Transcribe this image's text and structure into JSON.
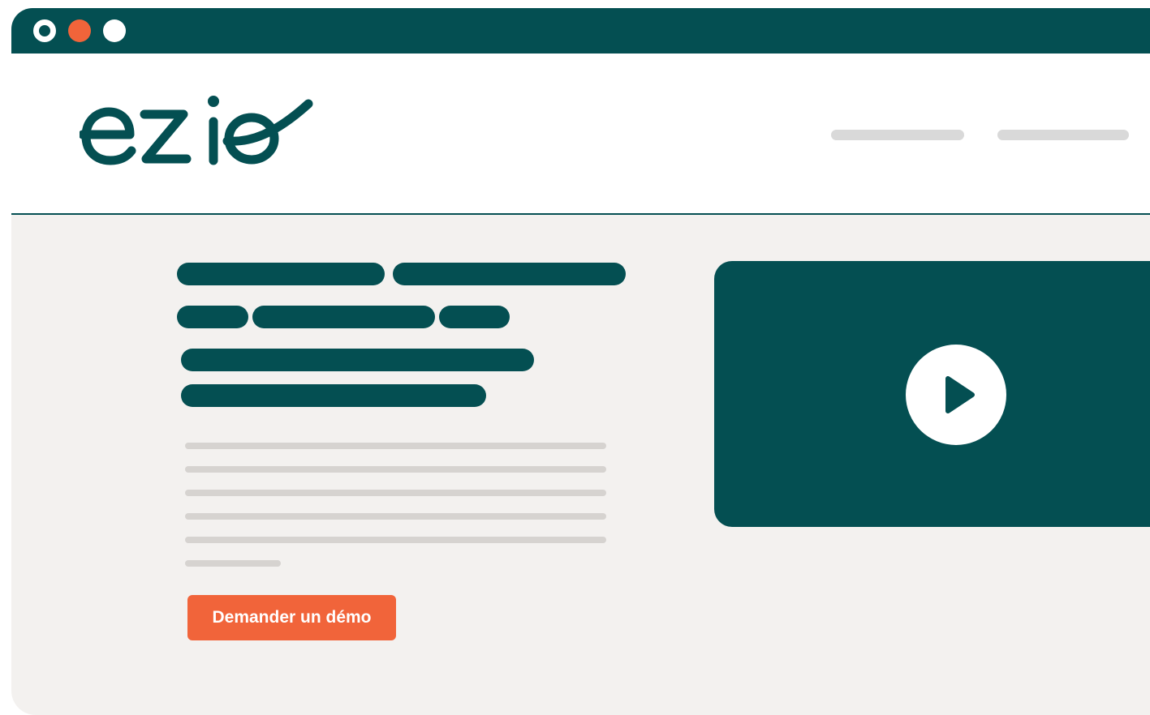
{
  "window": {
    "controls": [
      "window-dot-icon",
      "window-dot-icon",
      "window-dot-icon"
    ],
    "colors": {
      "primary": "#044f52",
      "accent": "#f1643a",
      "background": "#f3f1ef"
    }
  },
  "header": {
    "logo_text": "ezio",
    "nav_placeholders": 2
  },
  "hero": {
    "cta_label": "Demander un démo",
    "video_icon": "play-icon"
  }
}
